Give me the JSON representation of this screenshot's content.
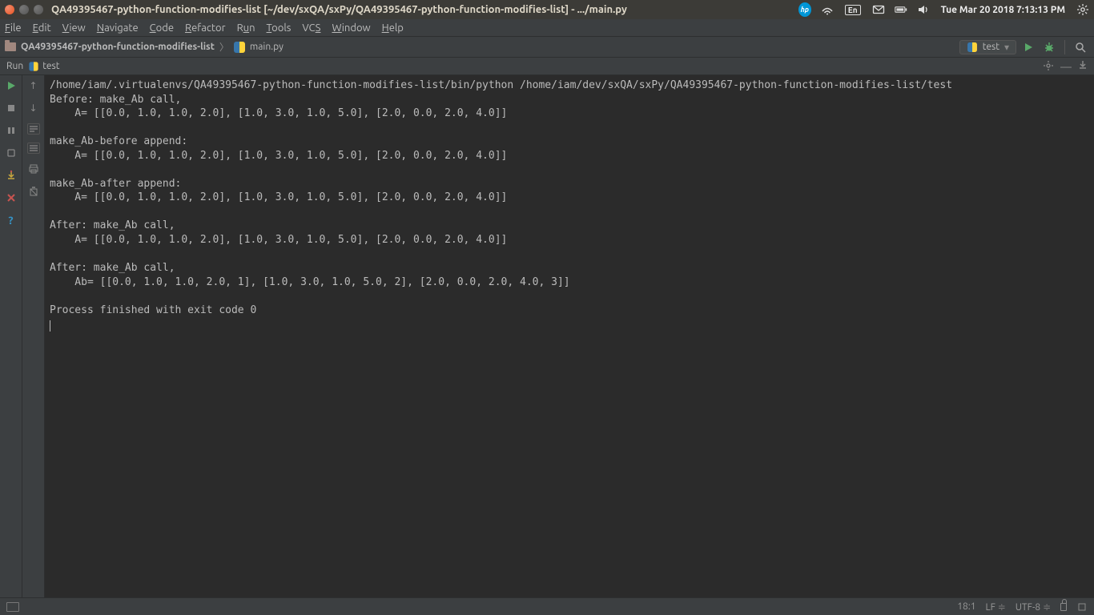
{
  "os_titlebar": {
    "title": "QA49395467-python-function-modifies-list [~/dev/sxQA/sxPy/QA49395467-python-function-modifies-list] - .../main.py",
    "tray": {
      "lang": "En",
      "datetime": "Tue Mar 20 2018  7:13:13 PM"
    }
  },
  "menubar": [
    "File",
    "Edit",
    "View",
    "Navigate",
    "Code",
    "Refactor",
    "Run",
    "Tools",
    "VCS",
    "Window",
    "Help"
  ],
  "breadcrumb": {
    "project": "QA49395467-python-function-modifies-list",
    "file": "main.py"
  },
  "run_config": {
    "label": "test"
  },
  "run_panel": {
    "title_prefix": "Run",
    "title_config": "test"
  },
  "console_lines": [
    "/home/iam/.virtualenvs/QA49395467-python-function-modifies-list/bin/python /home/iam/dev/sxQA/sxPy/QA49395467-python-function-modifies-list/test",
    "Before: make_Ab call,",
    "    A= [[0.0, 1.0, 1.0, 2.0], [1.0, 3.0, 1.0, 5.0], [2.0, 0.0, 2.0, 4.0]]",
    "",
    "make_Ab-before append:",
    "    A= [[0.0, 1.0, 1.0, 2.0], [1.0, 3.0, 1.0, 5.0], [2.0, 0.0, 2.0, 4.0]]",
    "",
    "make_Ab-after append:",
    "    A= [[0.0, 1.0, 1.0, 2.0], [1.0, 3.0, 1.0, 5.0], [2.0, 0.0, 2.0, 4.0]]",
    "",
    "After: make_Ab call,",
    "    A= [[0.0, 1.0, 1.0, 2.0], [1.0, 3.0, 1.0, 5.0], [2.0, 0.0, 2.0, 4.0]]",
    "",
    "After: make_Ab call,",
    "    Ab= [[0.0, 1.0, 1.0, 2.0, 1], [1.0, 3.0, 1.0, 5.0, 2], [2.0, 0.0, 2.0, 4.0, 3]]",
    "",
    "Process finished with exit code 0"
  ],
  "statusbar": {
    "position": "18:1",
    "line_sep": "LF",
    "encoding": "UTF-8"
  }
}
